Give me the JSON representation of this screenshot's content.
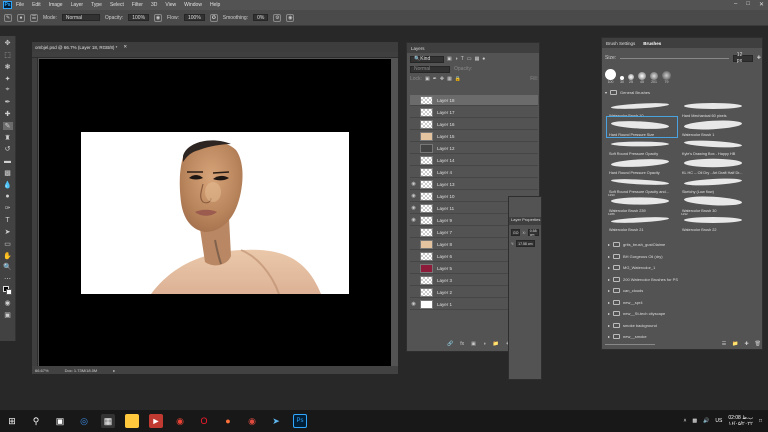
{
  "menubar": {
    "logo": "Ps",
    "items": [
      "File",
      "Edit",
      "Image",
      "Layer",
      "Type",
      "Select",
      "Filter",
      "3D",
      "View",
      "Window",
      "Help"
    ]
  },
  "options_bar": {
    "mode_label": "Mode:",
    "mode_value": "Normal",
    "opacity_label": "Opacity:",
    "opacity_value": "100%",
    "flow_label": "Flow:",
    "flow_value": "100%",
    "smoothing_label": "Smoothing:",
    "smoothing_value": "0%"
  },
  "document": {
    "tab_title": "ombjel.psd @ 66.7% (Layer 18, RGB/8) *",
    "zoom": "66.67%",
    "doc_size": "Doc: 1.73M/18.0M"
  },
  "layers_panel": {
    "title": "Layers",
    "filter_value": "Kind",
    "blend_value": "Normal",
    "opacity_label": "Opacity:",
    "fill_label": "Fill:",
    "layers": [
      {
        "name": "Layer 18",
        "visible": false,
        "selected": true,
        "thumb": "blank"
      },
      {
        "name": "Layer 17",
        "visible": false,
        "selected": false,
        "thumb": "blank"
      },
      {
        "name": "Layer 16",
        "visible": false,
        "selected": false,
        "thumb": "blank"
      },
      {
        "name": "Layer 15",
        "visible": false,
        "selected": false,
        "thumb": "tan"
      },
      {
        "name": "Layer 12",
        "visible": false,
        "selected": false,
        "thumb": "dark"
      },
      {
        "name": "Layer 14",
        "visible": false,
        "selected": false,
        "thumb": "blank"
      },
      {
        "name": "Layer 4",
        "visible": false,
        "selected": false,
        "thumb": "blank"
      },
      {
        "name": "Layer 13",
        "visible": true,
        "selected": false,
        "thumb": "blank"
      },
      {
        "name": "Layer 10",
        "visible": true,
        "selected": false,
        "thumb": "blank"
      },
      {
        "name": "Layer 11",
        "visible": true,
        "selected": false,
        "thumb": "blank"
      },
      {
        "name": "Layer 9",
        "visible": true,
        "selected": false,
        "thumb": "blank"
      },
      {
        "name": "Layer 7",
        "visible": false,
        "selected": false,
        "thumb": "blank"
      },
      {
        "name": "Layer 8",
        "visible": false,
        "selected": false,
        "thumb": "tan"
      },
      {
        "name": "Layer 6",
        "visible": false,
        "selected": false,
        "thumb": "blank"
      },
      {
        "name": "Layer 5",
        "visible": false,
        "selected": false,
        "thumb": "red"
      },
      {
        "name": "Layer 3",
        "visible": false,
        "selected": false,
        "thumb": "blank"
      },
      {
        "name": "Layer 2",
        "visible": false,
        "selected": false,
        "thumb": "blank"
      },
      {
        "name": "Layer 1",
        "visible": true,
        "selected": false,
        "thumb": "white"
      }
    ]
  },
  "properties_panel": {
    "title": "Layer Properties",
    "w_value": "0.58 cm",
    "h_value": "17.58 cm",
    "go_label": "GO",
    "x_label": "X:",
    "y_label": "Y:"
  },
  "brushes_panel": {
    "tab_settings": "Brush Settings",
    "tab_brushes": "Brushes",
    "size_label": "Size:",
    "size_value": "12 px",
    "presets": [
      "100",
      "30",
      "25",
      "45",
      "201",
      "79"
    ],
    "group_title": "General Brushes",
    "brushes": [
      {
        "num": "",
        "name": "Watercolor Brush 10"
      },
      {
        "num": "",
        "name": "Hard Mechanical 60 pixels"
      },
      {
        "num": "",
        "name": "Hard Round Pressure Size"
      },
      {
        "num": "",
        "name": "Watercolor Brush 1"
      },
      {
        "num": "",
        "name": "Soft Round Pressure Opacity"
      },
      {
        "num": "",
        "name": "Kyle's Drawing Box - Happy HB"
      },
      {
        "num": "",
        "name": "Hard Round Pressure Opacity"
      },
      {
        "num": "",
        "name": "KL HC -- Oil Dry - Art Draft Half Dr..."
      },
      {
        "num": "",
        "name": "Soft Round Pressure Opacity and..."
      },
      {
        "num": "",
        "name": "Sketchy (Low flow)"
      },
      {
        "num": "1293",
        "name": "Watercolor Brush 239"
      },
      {
        "num": "",
        "name": "Watercolor Brush 30"
      },
      {
        "num": "1286",
        "name": "Watercolor Brush 21"
      },
      {
        "num": "1292",
        "name": "Watercolor Brush 22"
      }
    ],
    "folders": [
      "grits_brush_gustOlalme",
      "BH Gorgeous Oil (dry)",
      "MG_Watercolor_1",
      "200 Watercolor Brushes for PS",
      "can_clouds",
      "new__spr4",
      "new__St-tech cityscape",
      "smoke background",
      "new__smoke"
    ]
  },
  "taskbar": {
    "time": "02:08 ب.ظ",
    "date": "۱۶/۰۵/۲۰۲۲",
    "lang": "US"
  }
}
